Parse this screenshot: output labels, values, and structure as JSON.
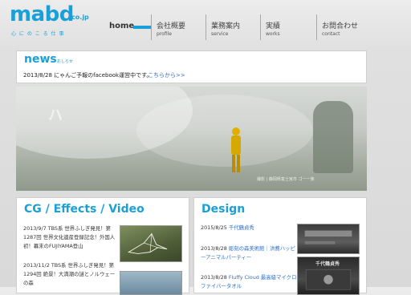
{
  "header": {
    "logo": "mabd",
    "logo_domain": ".co.jp",
    "tagline": "心 に の こ る 仕 事",
    "nav": [
      {
        "label": "home",
        "sub": ""
      },
      {
        "label": "会社概要",
        "sub": "profile"
      },
      {
        "label": "業務案内",
        "sub": "service"
      },
      {
        "label": "実績",
        "sub": "works"
      },
      {
        "label": "お問合わせ",
        "sub": "contact"
      }
    ]
  },
  "news": {
    "title": "news",
    "subtitle": "おしらせ",
    "item_text": "2013/8/28 にゃんご予報のfacebook運営中です。",
    "link_text": "こちらから>>"
  },
  "hero": {
    "ghost_text": "ハ",
    "caption": "撮影 | 静岡県富士宮市 ゴー一族"
  },
  "cg": {
    "title": "CG / Effects / Video",
    "entry1_date": "2013/9/7",
    "entry1_text": "TBS系 世界ふしぎ発見！第1287回 世界文化遺産登録記念！外国人初！幕末のFUJIYAMA登山",
    "entry2_date": "2013/11/2",
    "entry2_text": "TBS系 世界ふしぎ発見！第1294回 絶景！大満潮の謎とノルウェーの森"
  },
  "design": {
    "title": "Design",
    "entry1_date": "2015/8/25",
    "entry1_text": "千代鶴貞秀",
    "entry2_date": "2013/8/28",
    "entry2_text": "彫刻の森美術館｜洪蕎ハッピーアニマルパーティー",
    "entry3_date": "2013/8/28",
    "entry3_text": "Fluffy Cloud 最高級マイクロファイバータオル",
    "thumb2_label": "千代鶴貞秀"
  }
}
